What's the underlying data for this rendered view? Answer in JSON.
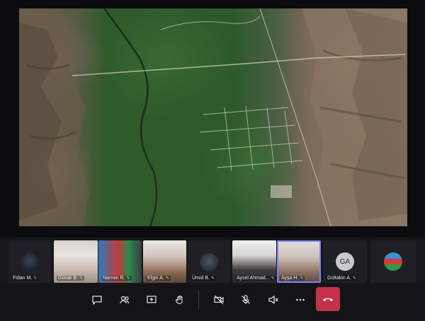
{
  "shared_content": {
    "description_icon": "satellite-map"
  },
  "participants": [
    {
      "name": "Fidan M.",
      "style": "photo-avatar"
    },
    {
      "name": "Günar B.",
      "style": "video"
    },
    {
      "name": "Narmin R.",
      "style": "video"
    },
    {
      "name": "Elgin A.",
      "style": "video"
    },
    {
      "name": "Ümid B.",
      "style": "photo-avatar"
    },
    {
      "name": "Aysel Ahmad...",
      "style": "video"
    },
    {
      "name": "Ayşa H.",
      "style": "video",
      "speaking": true
    },
    {
      "name": "Gültakin A.",
      "style": "initials",
      "initials": "GA"
    },
    {
      "name": "",
      "style": "flag-avatar"
    }
  ],
  "toolbar": {
    "buttons": [
      {
        "icon": "chat-icon"
      },
      {
        "icon": "people-icon"
      },
      {
        "icon": "share-screen-icon"
      },
      {
        "icon": "raise-hand-icon"
      },
      {
        "icon": "camera-off-icon"
      },
      {
        "icon": "mic-off-icon"
      },
      {
        "icon": "speaker-off-icon"
      },
      {
        "icon": "more-icon"
      },
      {
        "icon": "hang-up-icon"
      }
    ]
  },
  "colors": {
    "accent": "#7f85f5",
    "hangup": "#c4314b",
    "background": "#111114"
  }
}
